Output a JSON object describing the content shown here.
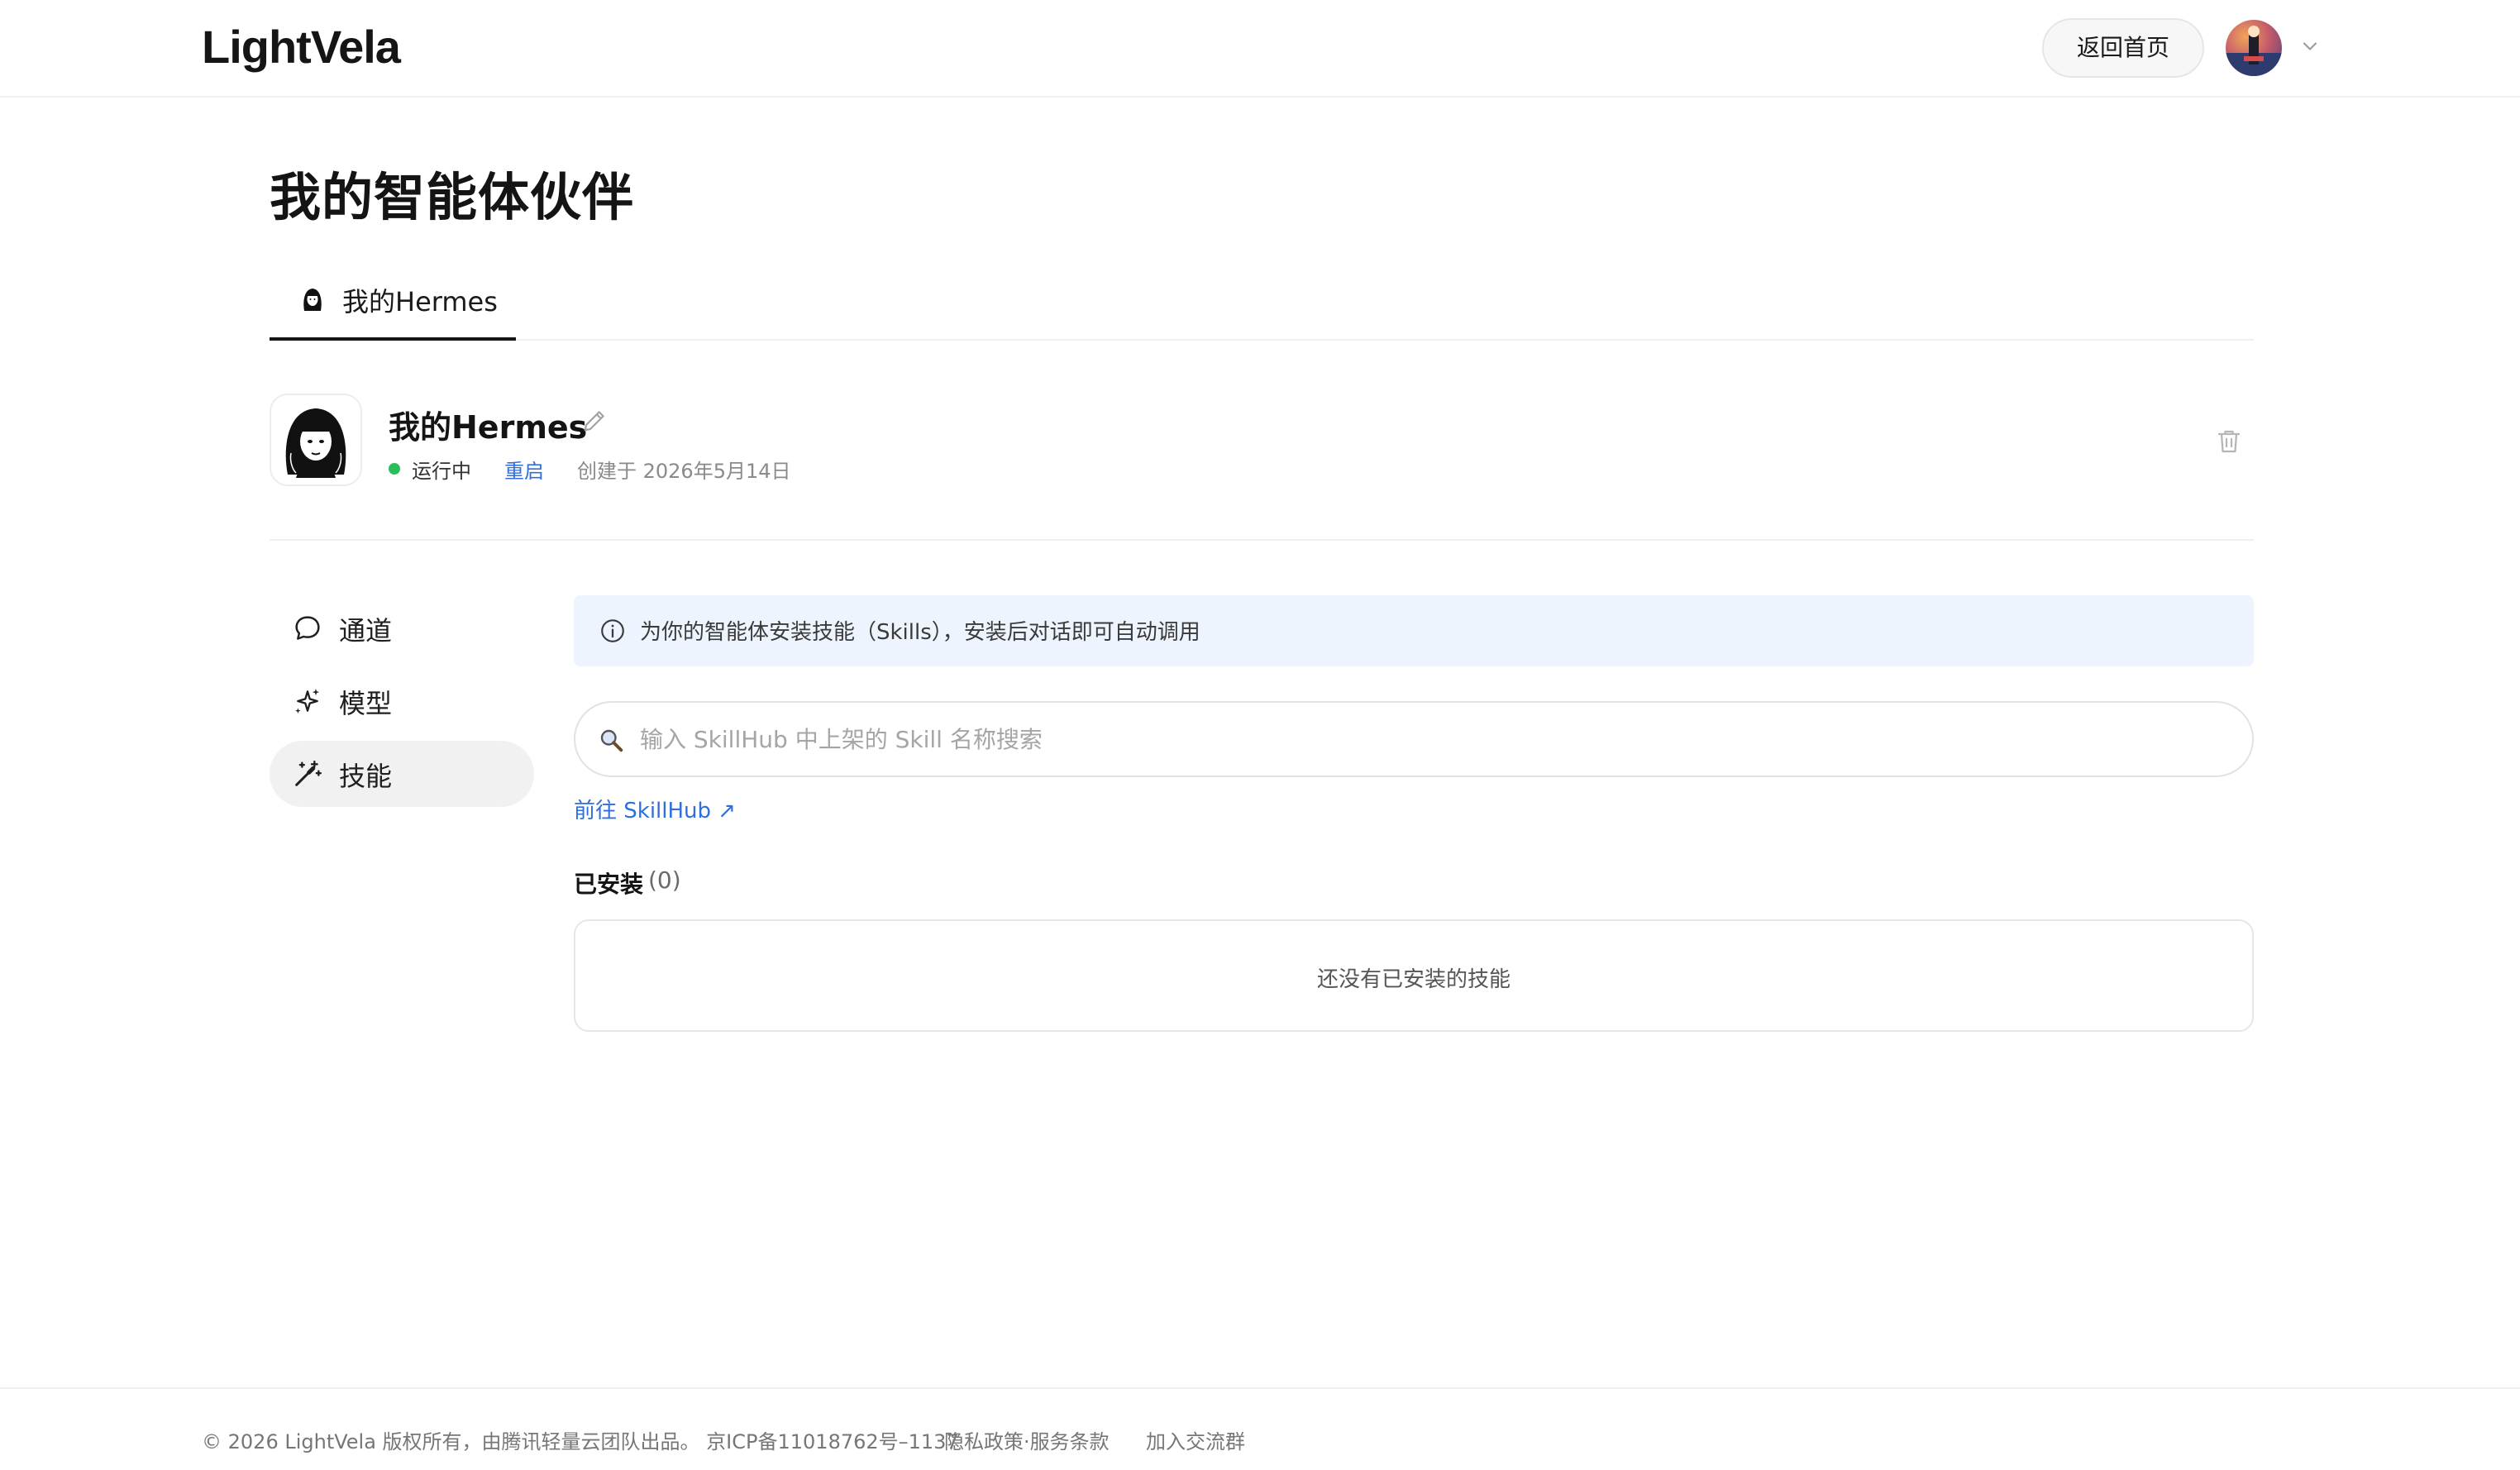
{
  "header": {
    "logo": "LightVela",
    "home_button": "返回首页"
  },
  "page": {
    "title": "我的智能体伙伴"
  },
  "tabs": [
    {
      "label": "我的Hermes"
    }
  ],
  "agent": {
    "name": "我的Hermes",
    "status": "运行中",
    "status_color": "#2bbd5a",
    "restart_label": "重启",
    "created": "创建于 2026年5月14日"
  },
  "sidenav": {
    "items": [
      {
        "label": "通道",
        "icon": "chat-bubble-icon"
      },
      {
        "label": "模型",
        "icon": "sparkle-icon"
      },
      {
        "label": "技能",
        "icon": "magic-wand-icon",
        "active": true
      }
    ]
  },
  "skills": {
    "info": "为你的智能体安装技能（Skills），安装后对话即可自动调用",
    "search_placeholder": "输入 SkillHub 中上架的 Skill 名称搜索",
    "search_value": "",
    "skillhub_link": "前往 SkillHub ↗",
    "installed_title": "已安装",
    "installed_count": "(0)",
    "empty_text": "还没有已安装的技能"
  },
  "footer": {
    "copyright": "© 2026 LightVela 版权所有，由腾讯轻量云团队出品。 京ICP备11018762号–1137",
    "policy": "隐私政策·服务条款",
    "group": "加入交流群"
  },
  "colors": {
    "accent": "#2f6fdd",
    "banner_bg": "#eef4fd",
    "active_nav_bg": "#f1f1f1"
  }
}
